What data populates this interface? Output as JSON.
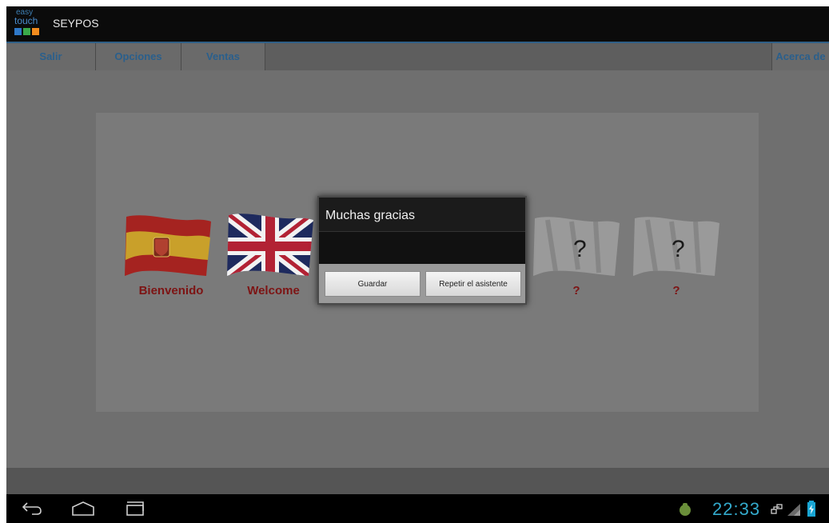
{
  "app": {
    "logo_line1": "easy",
    "logo_line2": "touch",
    "title": "SEYPOS"
  },
  "menu": {
    "items": [
      "Salir",
      "Opciones",
      "Ventas"
    ],
    "about": "Acerca de"
  },
  "languages": [
    {
      "label": "Bienvenido",
      "icon": "spain-flag-icon"
    },
    {
      "label": "Welcome",
      "icon": "uk-flag-icon"
    },
    {
      "label": "?",
      "icon": "unknown-flag-icon"
    },
    {
      "label": "?",
      "icon": "unknown-flag-icon"
    }
  ],
  "dialog": {
    "title": "Muchas gracias",
    "save_label": "Guardar",
    "repeat_label": "Repetir el asistente"
  },
  "status": {
    "time": "22:33"
  },
  "colors": {
    "accent": "#33aacc",
    "menu_text": "#2a5f8c",
    "label_red": "#7d1414"
  }
}
